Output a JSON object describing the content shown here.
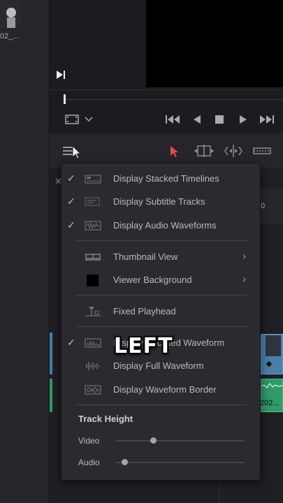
{
  "media_pool": {
    "clip_name": "02_..."
  },
  "timeline": {
    "ruler_zero": "0",
    "audio_clip_label": "202..."
  },
  "menu": {
    "items": [
      {
        "checked": true,
        "label": "Display Stacked Timelines",
        "icon": "stacked-timelines-icon"
      },
      {
        "checked": true,
        "label": "Display Subtitle Tracks",
        "icon": "subtitle-tracks-icon"
      },
      {
        "checked": true,
        "label": "Display Audio Waveforms",
        "icon": "audio-waveforms-icon"
      },
      {
        "checked": false,
        "label": "Thumbnail View",
        "icon": "thumbnail-view-icon",
        "submenu": true
      },
      {
        "checked": false,
        "label": "Viewer Background",
        "icon": "viewer-background-icon",
        "submenu": true
      },
      {
        "checked": false,
        "label": "Fixed Playhead",
        "icon": "fixed-playhead-icon"
      },
      {
        "checked": true,
        "label": "Display Rectified Waveform",
        "icon": "rectified-waveform-icon"
      },
      {
        "checked": false,
        "label": "Display Full Waveform",
        "icon": "full-waveform-icon"
      },
      {
        "checked": false,
        "label": "Display Waveform Border",
        "icon": "waveform-border-icon"
      }
    ],
    "check_glyph": "✓",
    "arrow_glyph": "›",
    "track_height": {
      "title": "Track Height",
      "video_label": "Video",
      "video_value": 0.29,
      "audio_label": "Audio",
      "audio_value": 0.07
    }
  },
  "overlay_caption": "LEFT",
  "colors": {
    "accent_pointer": "#e5484d",
    "video_clip": "#4a7fa8",
    "audio_clip": "#2f9a6a"
  }
}
